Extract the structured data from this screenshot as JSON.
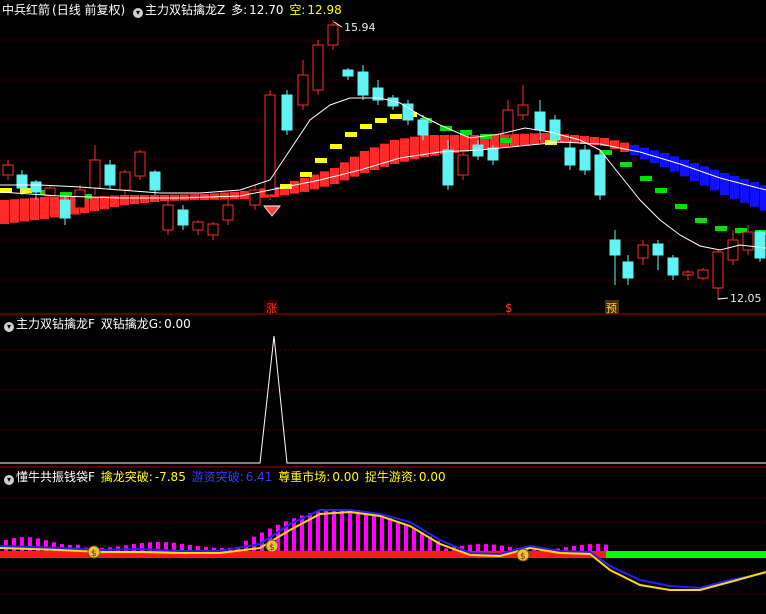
{
  "colors": {
    "background": "#000000",
    "grid": "#7a0000",
    "up_candle": "#ff2a2a",
    "down_candle": "#5ff3f3",
    "white_line": "#ffffff",
    "yellow": "#ffff00",
    "green": "#00e000",
    "blue": "#1010ff",
    "magenta": "#ff00ff"
  },
  "panel_main": {
    "stock_name": "中兵红箭",
    "period_label": "(日线 前复权)",
    "indicator_name": "主力双钻擒龙Z",
    "duo_label": "多:",
    "duo_value": "12.70",
    "kong_label": "空:",
    "kong_value": "12.98",
    "high_label": "15.94",
    "low_label": "12.05",
    "signals": [
      "涨",
      "$",
      "预"
    ]
  },
  "panel_mid": {
    "indicator_name": "主力双钻擒龙F",
    "series_label": "双钻擒龙G:",
    "series_value": "0.00"
  },
  "panel_bottom": {
    "indicator_name": "懂牛共振钱袋F",
    "s1_label": "擒龙突破:",
    "s1_value": "-7.85",
    "s2_label": "游资突破:",
    "s2_value": "6.41",
    "s3_label": "尊重市场:",
    "s3_value": "0.00",
    "s4_label": "捉牛游资:",
    "s4_value": "0.00"
  }
}
